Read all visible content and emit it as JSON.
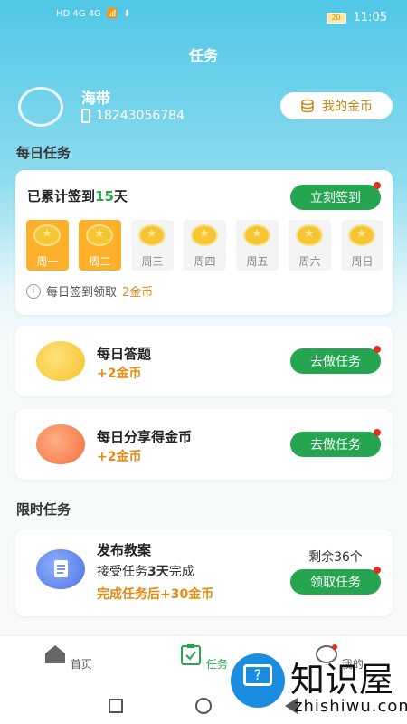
{
  "status_bar": {
    "time": "11:05",
    "battery": "20",
    "signal_left": "HD 4G 4G"
  },
  "header": {
    "title": "任务"
  },
  "user": {
    "name": "海带",
    "phone": "18243056784",
    "coin_button": "我的金币"
  },
  "daily": {
    "section_title": "每日任务",
    "signin_prefix": "已累计签到",
    "signin_days": "15",
    "signin_suffix": "天",
    "signin_button": "立刻签到",
    "days": [
      "周一",
      "周二",
      "周三",
      "周四",
      "周五",
      "周六",
      "周日"
    ],
    "done_days": 2,
    "tip_prefix": "每日签到领取",
    "tip_highlight": "2金币"
  },
  "tasks": [
    {
      "title": "每日答题",
      "reward": "+2金币",
      "button": "去做任务",
      "icon": "answer-icon",
      "color": "#f8c22a"
    },
    {
      "title": "每日分享得金币",
      "reward": "+2金币",
      "button": "去做任务",
      "icon": "share-icon",
      "color": "#f3703d"
    }
  ],
  "limited": {
    "section_title": "限时任务",
    "title": "发布教案",
    "sub_prefix": "接受任务",
    "sub_bold": "3天",
    "sub_suffix": "完成",
    "reward": "完成任务后+30金币",
    "remaining": "剩余36个",
    "button": "领取任务"
  },
  "nav": {
    "home": "首页",
    "task": "任务",
    "mine": "我的"
  },
  "watermark": {
    "cn": "知识屋",
    "en": "zhishiwu.com"
  },
  "colors": {
    "accent_green": "#26a550",
    "highlight_orange": "#e58a12",
    "header_blue": "#4fc7e6"
  }
}
